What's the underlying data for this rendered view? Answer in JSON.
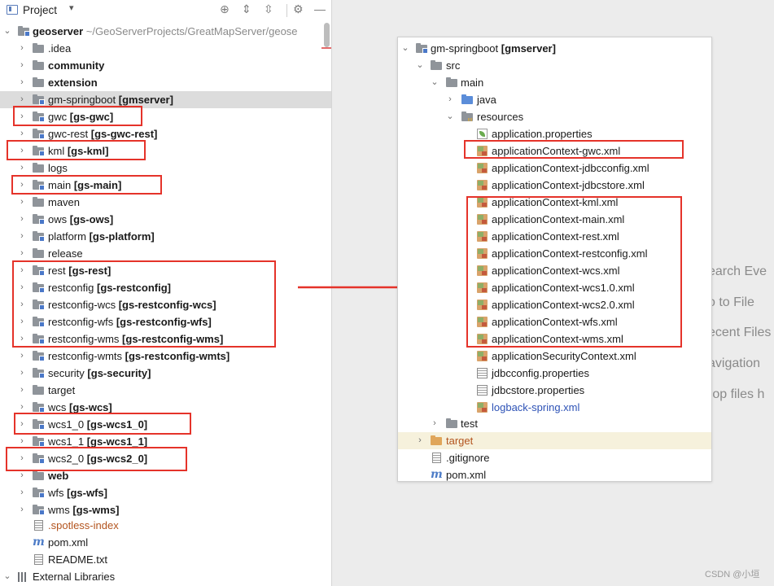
{
  "left": {
    "toolbar": {
      "title": "Project",
      "caret": "▾",
      "icons": [
        "crosshair-icon",
        "expand-all-icon",
        "collapse-all-icon",
        "gear-icon",
        "minimize-icon"
      ]
    },
    "root": {
      "name": "geoserver",
      "path": "~/GeoServerProjects/GreatMapServer/geose"
    },
    "items": [
      {
        "name": ".idea",
        "module": ""
      },
      {
        "name": "community",
        "module": ""
      },
      {
        "name": "extension",
        "module": ""
      },
      {
        "name": "gm-springboot",
        "module": "[gmserver]"
      },
      {
        "name": "gwc",
        "module": "[gs-gwc]"
      },
      {
        "name": "gwc-rest",
        "module": "[gs-gwc-rest]"
      },
      {
        "name": "kml",
        "module": "[gs-kml]"
      },
      {
        "name": "logs",
        "module": ""
      },
      {
        "name": "main",
        "module": "[gs-main]"
      },
      {
        "name": "maven",
        "module": ""
      },
      {
        "name": "ows",
        "module": "[gs-ows]"
      },
      {
        "name": "platform",
        "module": "[gs-platform]"
      },
      {
        "name": "release",
        "module": ""
      },
      {
        "name": "rest",
        "module": "[gs-rest]"
      },
      {
        "name": "restconfig",
        "module": "[gs-restconfig]"
      },
      {
        "name": "restconfig-wcs",
        "module": "[gs-restconfig-wcs]"
      },
      {
        "name": "restconfig-wfs",
        "module": "[gs-restconfig-wfs]"
      },
      {
        "name": "restconfig-wms",
        "module": "[gs-restconfig-wms]"
      },
      {
        "name": "restconfig-wmts",
        "module": "[gs-restconfig-wmts]"
      },
      {
        "name": "security",
        "module": "[gs-security]"
      },
      {
        "name": "target",
        "module": ""
      },
      {
        "name": "wcs",
        "module": "[gs-wcs]"
      },
      {
        "name": "wcs1_0",
        "module": "[gs-wcs1_0]"
      },
      {
        "name": "wcs1_1",
        "module": "[gs-wcs1_1]"
      },
      {
        "name": "wcs2_0",
        "module": "[gs-wcs2_0]"
      },
      {
        "name": "web",
        "module": ""
      },
      {
        "name": "wfs",
        "module": "[gs-wfs]"
      },
      {
        "name": "wms",
        "module": "[gs-wms]"
      }
    ],
    "files": [
      {
        "name": ".spotless-index"
      },
      {
        "name": "pom.xml"
      },
      {
        "name": "README.txt"
      }
    ],
    "external": "External Libraries"
  },
  "right": {
    "root": {
      "name": "gm-springboot",
      "module": "[gmserver]"
    },
    "src": "src",
    "main": "main",
    "java": "java",
    "resources": "resources",
    "resource_files": [
      "application.properties",
      "applicationContext-gwc.xml",
      "applicationContext-jdbcconfig.xml",
      "applicationContext-jdbcstore.xml",
      "applicationContext-kml.xml",
      "applicationContext-main.xml",
      "applicationContext-rest.xml",
      "applicationContext-restconfig.xml",
      "applicationContext-wcs.xml",
      "applicationContext-wcs1.0.xml",
      "applicationContext-wcs2.0.xml",
      "applicationContext-wfs.xml",
      "applicationContext-wms.xml",
      "applicationSecurityContext.xml",
      "jdbcconfig.properties",
      "jdbcstore.properties",
      "logback-spring.xml"
    ],
    "test": "test",
    "target": "target",
    "gitignore": ".gitignore",
    "pom": "pom.xml"
  },
  "hints": [
    "earch Eve",
    "o to File",
    "ecent Files",
    "avigation",
    "rop files h"
  ],
  "watermark": "CSDN @小垣",
  "colors": {
    "highlight": "#e5332a",
    "arrow": "#e5332a",
    "module_blue": "#4a78c8"
  }
}
